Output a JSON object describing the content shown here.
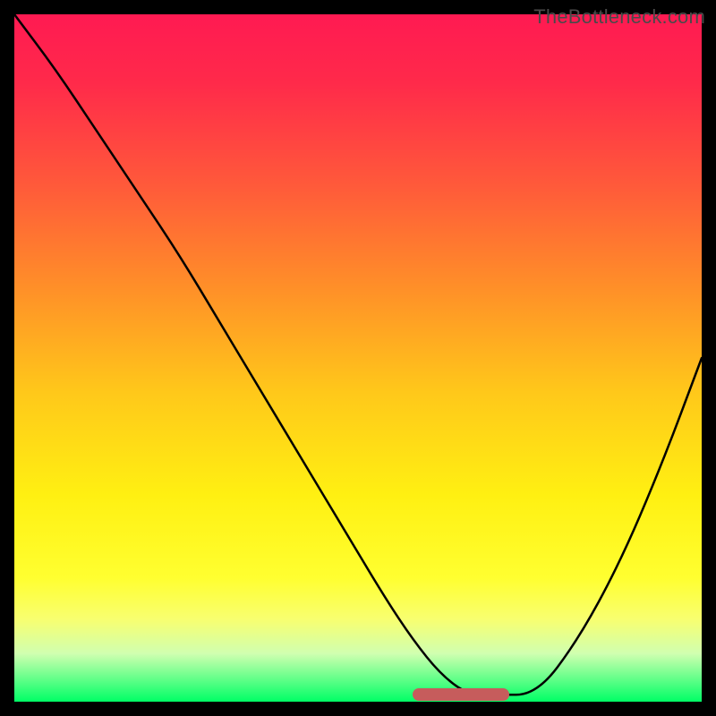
{
  "watermark": "TheBottleneck.com",
  "chart_data": {
    "type": "line",
    "title": "",
    "xlabel": "",
    "ylabel": "",
    "xlim": [
      0,
      100
    ],
    "ylim": [
      0,
      100
    ],
    "background_gradient": [
      "#ff1a52",
      "#ff5a3a",
      "#ffc81a",
      "#ffff30",
      "#00ff66"
    ],
    "series": [
      {
        "name": "bottleneck-curve",
        "x": [
          0,
          6,
          12,
          18,
          24,
          30,
          36,
          42,
          48,
          54,
          58,
          62,
          66,
          70,
          76,
          82,
          88,
          94,
          100
        ],
        "y": [
          100,
          92,
          83,
          74,
          65,
          55,
          45,
          35,
          25,
          15,
          9,
          4,
          1,
          1,
          1,
          9,
          20,
          34,
          50
        ]
      }
    ],
    "marker_band": {
      "x_start": 58,
      "x_end": 72,
      "y": 1
    },
    "colors": {
      "curve": "#000000",
      "marker": "#c65c5c"
    }
  }
}
